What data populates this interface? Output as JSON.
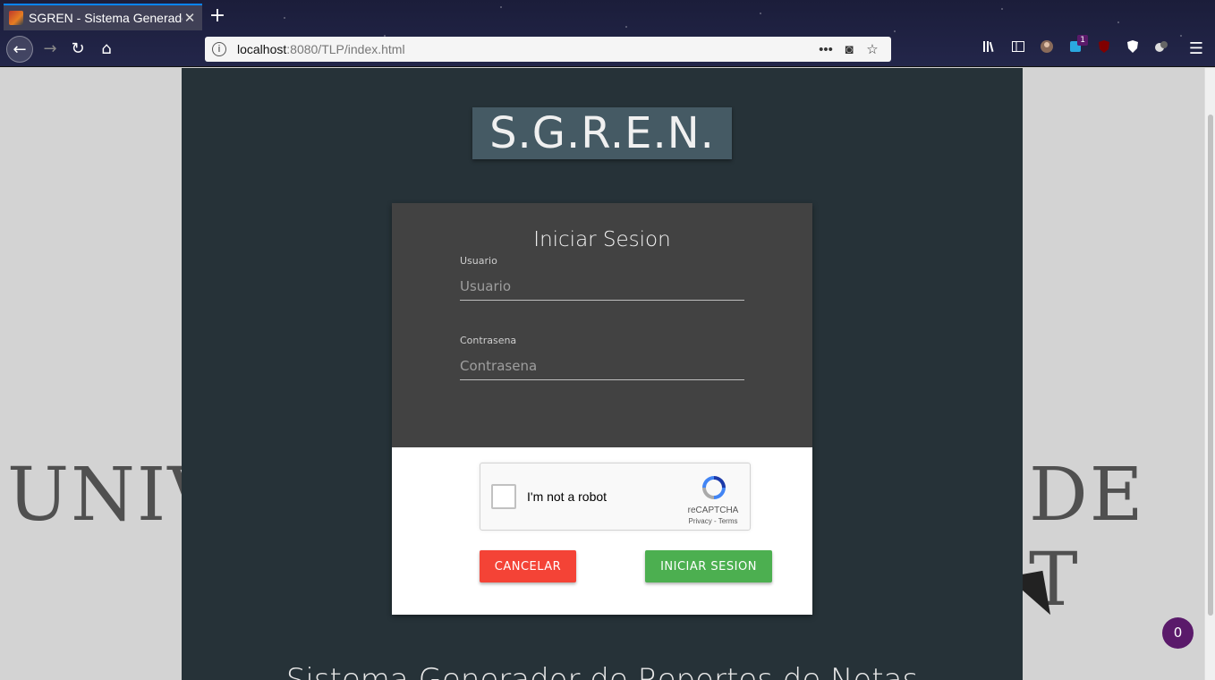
{
  "browser": {
    "tab_title": "SGREN - Sistema Generador",
    "tab_close": "✕",
    "new_tab": "+",
    "nav": {
      "back": "←",
      "forward": "→",
      "reload": "↻",
      "home": "⌂"
    },
    "url_host": "localhost",
    "url_path": ":8080/TLP/index.html",
    "url_info": "i",
    "url_icons": {
      "more": "•••",
      "pocket": "◙",
      "bookmark": "☆"
    },
    "toolbar_icons": [
      "library-icon",
      "sidebar-icon",
      "profile-icon",
      "extension-badge-icon",
      "ublock-icon",
      "shield-icon",
      "extension-icon"
    ],
    "extension_badge": "1",
    "menu": "☰"
  },
  "page": {
    "background_text_left": "UNIV",
    "background_text_right": "DE T",
    "logo": "S.G.R.E.N.",
    "login": {
      "title": "Iniciar Sesion",
      "user_label": "Usuario",
      "user_placeholder": "Usuario",
      "pass_label": "Contrasena",
      "pass_placeholder": "Contrasena"
    },
    "captcha": {
      "text": "I'm not a robot",
      "brand": "reCAPTCHA",
      "links": "Privacy - Terms"
    },
    "buttons": {
      "cancel": "CANCELAR",
      "login": "INICIAR SESION"
    },
    "footer_title": "Sistema Generador de Reportes de Notas",
    "chat_count": "0"
  },
  "colors": {
    "panel": "#263238",
    "logo_bg": "#455a64",
    "card_top": "#424242",
    "cancel": "#f44336",
    "login": "#4caf50",
    "chat": "#5a1a6a"
  }
}
